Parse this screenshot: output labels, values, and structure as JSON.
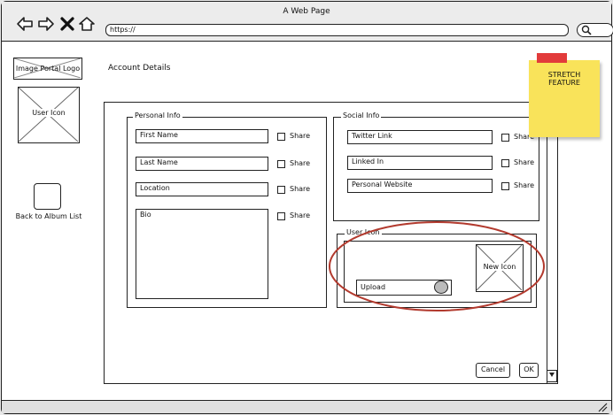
{
  "browser": {
    "title": "A Web Page",
    "url": "https://",
    "nav_icons": [
      "back-arrow-icon",
      "forward-arrow-icon",
      "close-x-icon",
      "home-icon"
    ]
  },
  "sidebar": {
    "logo": "Image Portal Logo",
    "user_icon": "User Icon",
    "back_label": "Back to Album List"
  },
  "main": {
    "heading": "Account Details"
  },
  "personal_info": {
    "legend": "Personal Info",
    "fields": [
      {
        "value": "First Name",
        "share": "Share"
      },
      {
        "value": "Last Name",
        "share": "Share"
      },
      {
        "value": "Location",
        "share": "Share"
      },
      {
        "value": "Bio",
        "share": "Share"
      }
    ]
  },
  "social_info": {
    "legend": "Social Info",
    "fields": [
      {
        "value": "Twitter Link",
        "share": "Share"
      },
      {
        "value": "Linked In",
        "share": "Share"
      },
      {
        "value": "Personal Website",
        "share": "Share"
      }
    ]
  },
  "user_icon_group": {
    "legend": "User Icon",
    "new_icon": "New Icon",
    "upload": "Upload"
  },
  "actions": {
    "cancel": "Cancel",
    "ok": "OK"
  },
  "sticky": {
    "text_line1": "STRETCH",
    "text_line2": "FEATURE"
  },
  "colors": {
    "sticky": "#f9e35a",
    "tape": "#e23b3b",
    "highlight_ellipse": "#b23a2e"
  }
}
